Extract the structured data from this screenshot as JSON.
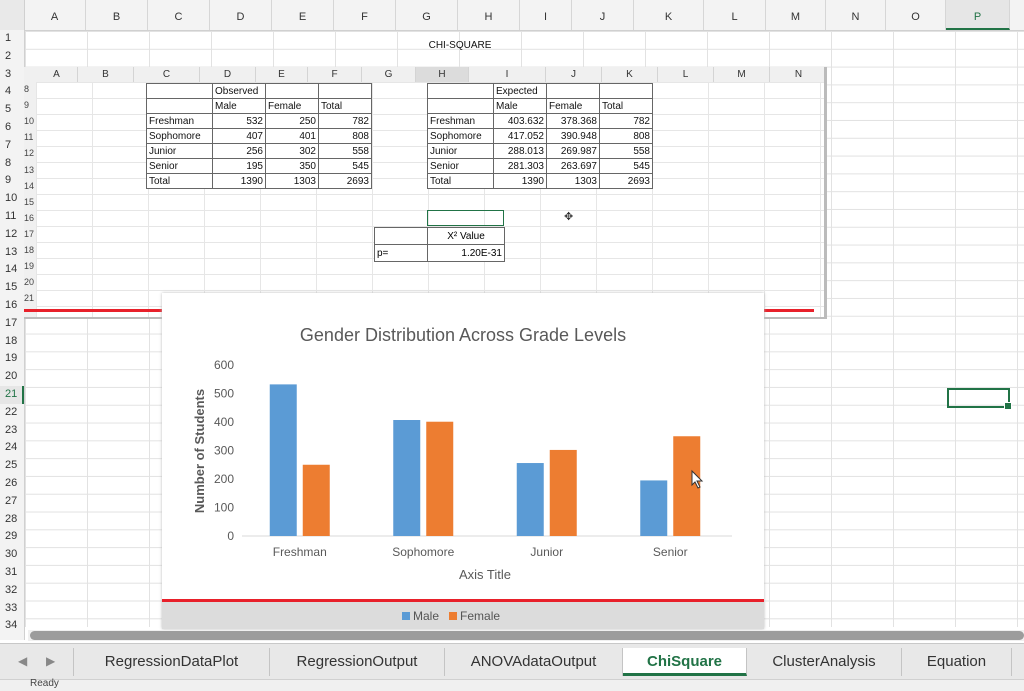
{
  "outer_columns": [
    "A",
    "B",
    "C",
    "D",
    "E",
    "F",
    "G",
    "H",
    "I",
    "J",
    "K",
    "L",
    "M",
    "N",
    "O",
    "P"
  ],
  "selected_column": "P",
  "outer_rows": [
    "1",
    "2",
    "3",
    "4",
    "5",
    "6",
    "7",
    "8",
    "9",
    "10",
    "11",
    "12",
    "13",
    "14",
    "15",
    "16",
    "17",
    "18",
    "19",
    "20",
    "21",
    "22",
    "23",
    "24",
    "25",
    "26",
    "27",
    "28",
    "29",
    "30",
    "31",
    "32",
    "33",
    "34"
  ],
  "selected_row": "21",
  "sheet_title": "CHI-SQUARE",
  "inner_columns": [
    "A",
    "B",
    "C",
    "D",
    "E",
    "F",
    "G",
    "H",
    "I",
    "J",
    "K",
    "L",
    "M",
    "N"
  ],
  "inner_rows": [
    "8",
    "9",
    "10",
    "11",
    "12",
    "13",
    "14",
    "15",
    "16",
    "17",
    "18",
    "19",
    "20",
    "21"
  ],
  "observed": {
    "header": "Observed",
    "columns": [
      "Male",
      "Female",
      "Total"
    ],
    "rows": [
      {
        "label": "Freshman",
        "values": [
          "532",
          "250",
          "782"
        ]
      },
      {
        "label": "Sophomore",
        "values": [
          "407",
          "401",
          "808"
        ]
      },
      {
        "label": "Junior",
        "values": [
          "256",
          "302",
          "558"
        ]
      },
      {
        "label": "Senior",
        "values": [
          "195",
          "350",
          "545"
        ]
      },
      {
        "label": "Total",
        "values": [
          "1390",
          "1303",
          "2693"
        ]
      }
    ]
  },
  "expected": {
    "header": "Expected",
    "columns": [
      "Male",
      "Female",
      "Total"
    ],
    "rows": [
      {
        "label": "Freshman",
        "values": [
          "403.632",
          "378.368",
          "782"
        ]
      },
      {
        "label": "Sophomore",
        "values": [
          "417.052",
          "390.948",
          "808"
        ]
      },
      {
        "label": "Junior",
        "values": [
          "288.013",
          "269.987",
          "558"
        ]
      },
      {
        "label": "Senior",
        "values": [
          "281.303",
          "263.697",
          "545"
        ]
      },
      {
        "label": "Total",
        "values": [
          "1390",
          "1303",
          "2693"
        ]
      }
    ]
  },
  "chisq": {
    "label": "X² Value",
    "p_label": "p=",
    "p_value": "1.20E-31"
  },
  "chart_data": {
    "type": "bar",
    "title": "Gender Distribution Across Grade Levels",
    "xlabel": "Axis Title",
    "ylabel": "Number of Students",
    "categories": [
      "Freshman",
      "Sophomore",
      "Junior",
      "Senior"
    ],
    "series": [
      {
        "name": "Male",
        "values": [
          532,
          407,
          256,
          195
        ],
        "color": "#5b9bd5"
      },
      {
        "name": "Female",
        "values": [
          250,
          401,
          302,
          350
        ],
        "color": "#ed7d31"
      }
    ],
    "ylim": [
      0,
      600
    ],
    "yticks": [
      0,
      100,
      200,
      300,
      400,
      500,
      600
    ],
    "grid": false,
    "legend": "bottom"
  },
  "sheet_tabs": [
    "RegressionDataPlot",
    "RegressionOutput",
    "ANOVAdataOutput",
    "ChiSquare",
    "ClusterAnalysis",
    "Equation"
  ],
  "active_tab": "ChiSquare",
  "nav_prev": "◀",
  "nav_next": "▶",
  "status_text": "Ready"
}
